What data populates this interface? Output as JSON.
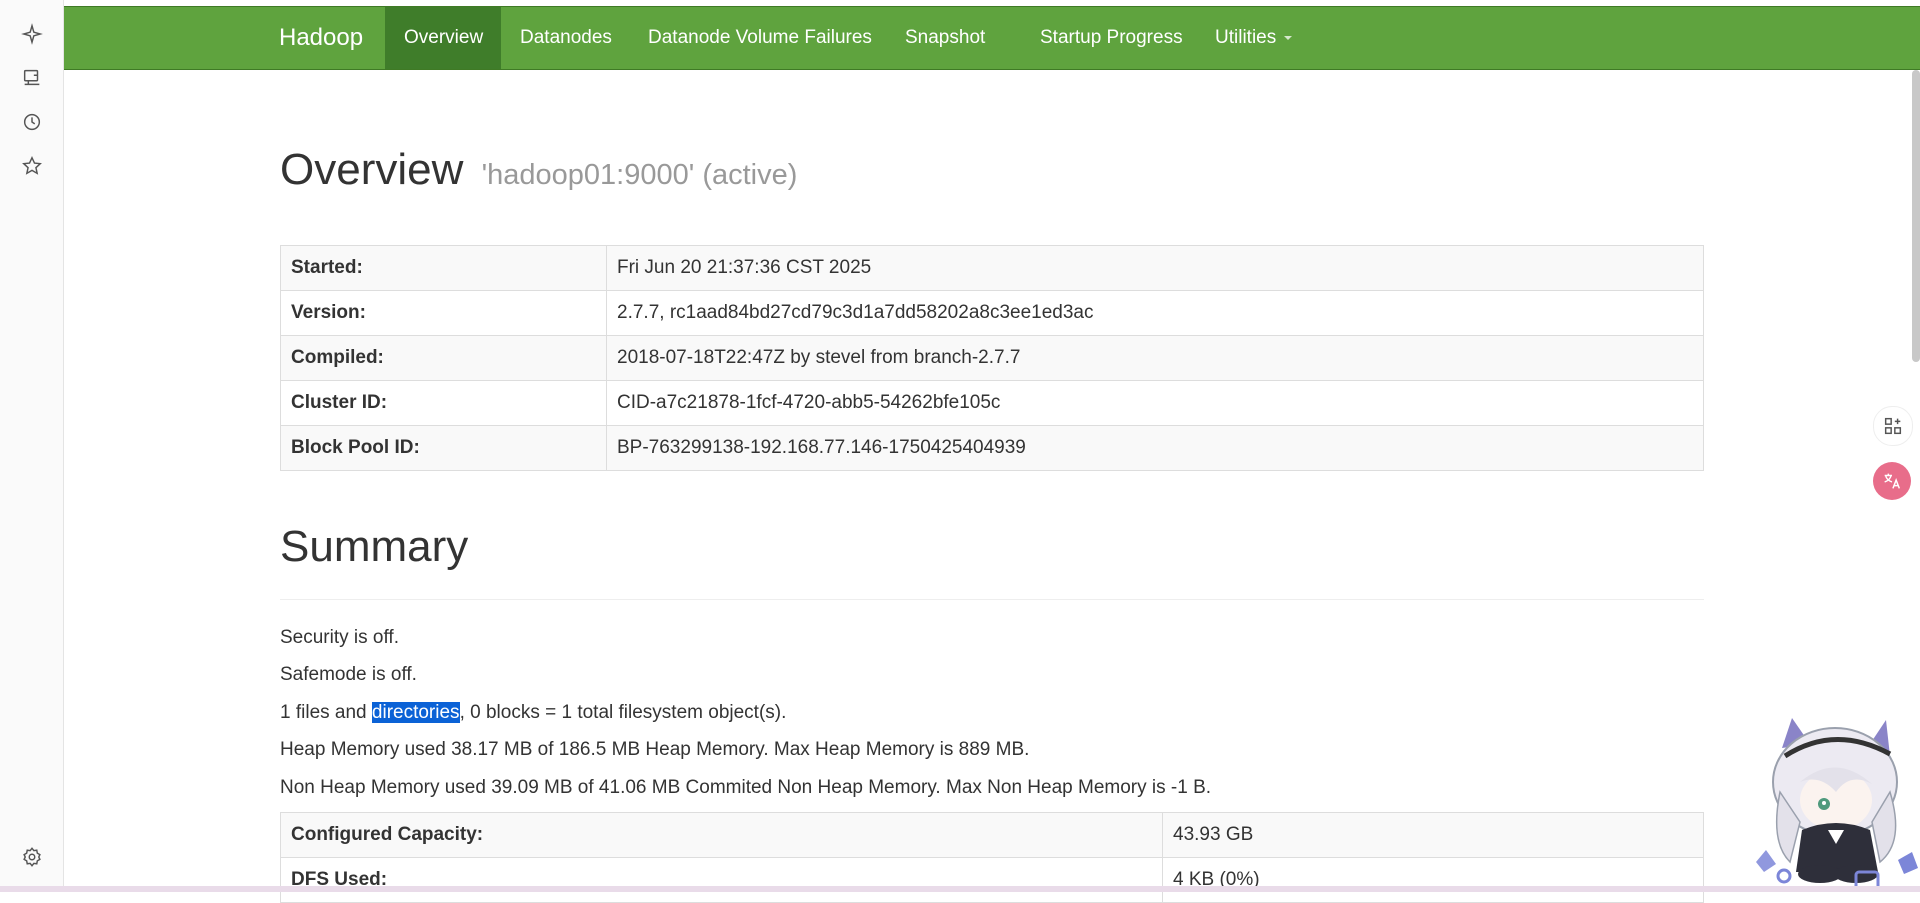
{
  "browser_sidebar": {
    "icons": [
      "sparkle-icon",
      "tv-icon",
      "history-icon",
      "star-icon",
      "settings-icon"
    ]
  },
  "navbar": {
    "brand": "Hadoop",
    "items": [
      {
        "label": "Overview",
        "active": true
      },
      {
        "label": "Datanodes",
        "active": false
      },
      {
        "label": "Datanode Volume Failures",
        "active": false
      },
      {
        "label": "Snapshot",
        "active": false
      },
      {
        "label": "Startup Progress",
        "active": false
      },
      {
        "label": "Utilities",
        "active": false,
        "dropdown": true
      }
    ],
    "color": "#5fa33e",
    "active_color": "#3f7d2a"
  },
  "overview": {
    "title": "Overview",
    "subtitle": "'hadoop01:9000' (active)",
    "rows": [
      {
        "key": "Started:",
        "value": "Fri Jun 20 21:37:36 CST 2025"
      },
      {
        "key": "Version:",
        "value": "2.7.7, rc1aad84bd27cd79c3d1a7dd58202a8c3ee1ed3ac"
      },
      {
        "key": "Compiled:",
        "value": "2018-07-18T22:47Z by stevel from branch-2.7.7"
      },
      {
        "key": "Cluster ID:",
        "value": "CID-a7c21878-1fcf-4720-abb5-54262bfe105c"
      },
      {
        "key": "Block Pool ID:",
        "value": "BP-763299138-192.168.77.146-1750425404939"
      }
    ]
  },
  "summary": {
    "title": "Summary",
    "security": "Security is off.",
    "safemode": "Safemode is off.",
    "files_pre": "1 files and ",
    "files_highlight": "directories",
    "files_post": ", 0 blocks = 1 total filesystem object(s).",
    "heap": "Heap Memory used 38.17 MB of 186.5 MB Heap Memory. Max Heap Memory is 889 MB.",
    "nonheap": "Non Heap Memory used 39.09 MB of 41.06 MB Commited Non Heap Memory. Max Non Heap Memory is -1 B.",
    "rows": [
      {
        "key": "Configured Capacity:",
        "value": "43.93 GB"
      },
      {
        "key": "DFS Used:",
        "value": "4 KB (0%)"
      }
    ]
  },
  "floating": {
    "icons": [
      "apps-add-icon",
      "translate-icon"
    ],
    "translate_color": "#e86d8a"
  }
}
